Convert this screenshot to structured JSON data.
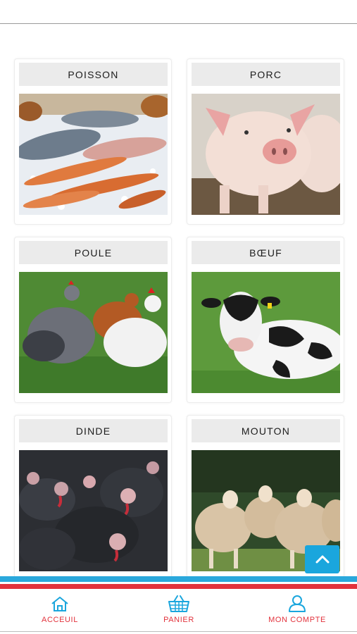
{
  "categories": [
    {
      "name": "POISSON",
      "image": "fish-on-ice-photo"
    },
    {
      "name": "PORC",
      "image": "pig-photo"
    },
    {
      "name": "POULE",
      "image": "hens-photo"
    },
    {
      "name": "BŒUF",
      "image": "cow-photo"
    },
    {
      "name": "DINDE",
      "image": "turkeys-photo"
    },
    {
      "name": "MOUTON",
      "image": "sheep-photo"
    }
  ],
  "scroll_top": {
    "icon": "chevron-up-icon"
  },
  "bottom_nav": {
    "items": [
      {
        "label": "ACCEUIL",
        "icon": "home-icon"
      },
      {
        "label": "PANIER",
        "icon": "basket-icon"
      },
      {
        "label": "MON COMPTE",
        "icon": "user-icon"
      }
    ]
  },
  "colors": {
    "accent_blue": "#2aa8dc",
    "accent_red": "#e2323c",
    "label_bg": "#ebebeb"
  }
}
